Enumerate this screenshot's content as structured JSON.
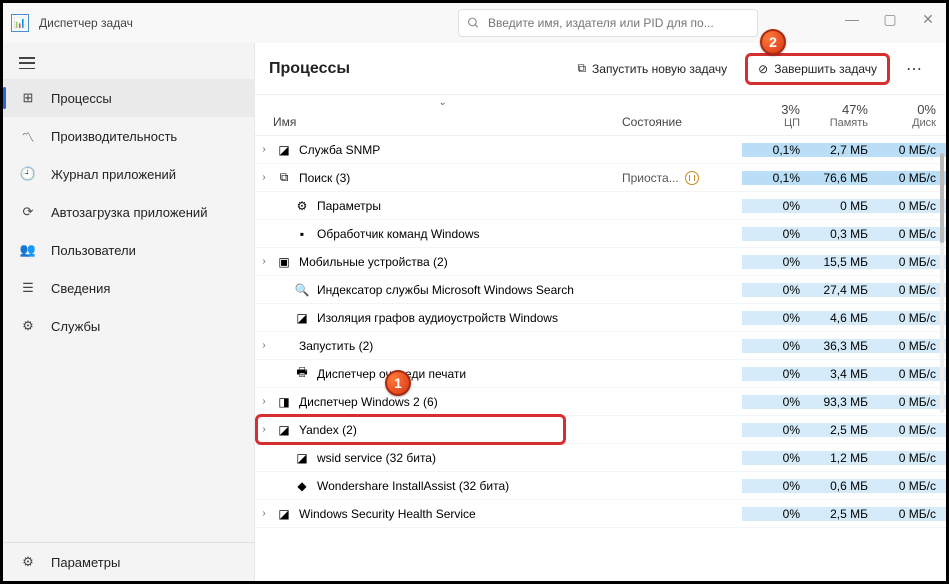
{
  "titlebar": {
    "app_title": "Диспетчер задач",
    "search_placeholder": "Введите имя, издателя или PID для по..."
  },
  "sidebar": {
    "items": [
      {
        "label": "Процессы"
      },
      {
        "label": "Производительность"
      },
      {
        "label": "Журнал приложений"
      },
      {
        "label": "Автозагрузка приложений"
      },
      {
        "label": "Пользователи"
      },
      {
        "label": "Сведения"
      },
      {
        "label": "Службы"
      }
    ],
    "settings_label": "Параметры"
  },
  "toolbar": {
    "title": "Процессы",
    "run_new_task": "Запустить новую задачу",
    "end_task": "Завершить задачу"
  },
  "columns": {
    "name": "Имя",
    "status": "Состояние",
    "cpu_pct": "3%",
    "cpu_lbl": "ЦП",
    "mem_pct": "47%",
    "mem_lbl": "Память",
    "disk_pct": "0%",
    "disk_lbl": "Диск"
  },
  "processes": [
    {
      "expand": true,
      "indent": 0,
      "icon": "◪",
      "name": "Служба SNMP",
      "status": "",
      "cpu": "0,1%",
      "mem": "2,7 МБ",
      "disk": "0 МБ/с",
      "hl": "hl"
    },
    {
      "expand": true,
      "indent": 0,
      "icon": "⧉",
      "name": "Поиск (3)",
      "status": "Приоста...",
      "paused": true,
      "cpu": "0,1%",
      "mem": "76,6 МБ",
      "disk": "0 МБ/с",
      "hl": "hl"
    },
    {
      "expand": false,
      "indent": 1,
      "icon": "⚙",
      "name": "Параметры",
      "status": "",
      "cpu": "0%",
      "mem": "0 МБ",
      "disk": "0 МБ/с",
      "hl": "hl2"
    },
    {
      "expand": false,
      "indent": 1,
      "icon": "▪",
      "name": "Обработчик команд Windows",
      "status": "",
      "cpu": "0%",
      "mem": "0,3 МБ",
      "disk": "0 МБ/с",
      "hl": "hl2"
    },
    {
      "expand": true,
      "indent": 0,
      "icon": "▣",
      "name": "Мобильные устройства (2)",
      "status": "",
      "cpu": "0%",
      "mem": "15,5 МБ",
      "disk": "0 МБ/с",
      "hl": "hl2"
    },
    {
      "expand": false,
      "indent": 1,
      "icon": "🔍",
      "name": "Индексатор службы Microsoft Windows Search",
      "status": "",
      "cpu": "0%",
      "mem": "27,4 МБ",
      "disk": "0 МБ/с",
      "hl": "hl2"
    },
    {
      "expand": false,
      "indent": 1,
      "icon": "◪",
      "name": "Изоляция графов аудиоустройств Windows",
      "status": "",
      "cpu": "0%",
      "mem": "4,6 МБ",
      "disk": "0 МБ/с",
      "hl": "hl2"
    },
    {
      "expand": true,
      "indent": 0,
      "icon": "",
      "name": "Запустить (2)",
      "status": "",
      "cpu": "0%",
      "mem": "36,3 МБ",
      "disk": "0 МБ/с",
      "hl": "hl2"
    },
    {
      "expand": false,
      "indent": 1,
      "icon": "🖶",
      "name": "Диспетчер очереди печати",
      "status": "",
      "cpu": "0%",
      "mem": "3,4 МБ",
      "disk": "0 МБ/с",
      "hl": "hl2"
    },
    {
      "expand": true,
      "indent": 0,
      "icon": "◨",
      "name": "Диспетчер Windows  2 (6)",
      "status": "",
      "cpu": "0%",
      "mem": "93,3 МБ",
      "disk": "0 МБ/с",
      "hl": "hl2",
      "callout1": true
    },
    {
      "expand": true,
      "indent": 0,
      "icon": "◪",
      "name": "Yandex (2)",
      "status": "",
      "cpu": "0%",
      "mem": "2,5 МБ",
      "disk": "0 МБ/с",
      "hl": "hl2",
      "highlighted": true
    },
    {
      "expand": false,
      "indent": 1,
      "icon": "◪",
      "name": "wsid service (32 бита)",
      "status": "",
      "cpu": "0%",
      "mem": "1,2 МБ",
      "disk": "0 МБ/с",
      "hl": "hl2"
    },
    {
      "expand": false,
      "indent": 1,
      "icon": "◆",
      "name": "Wondershare InstallAssist (32 бита)",
      "status": "",
      "cpu": "0%",
      "mem": "0,6 МБ",
      "disk": "0 МБ/с",
      "hl": "hl2"
    },
    {
      "expand": true,
      "indent": 0,
      "icon": "◪",
      "name": "Windows Security Health Service",
      "status": "",
      "cpu": "0%",
      "mem": "2,5 МБ",
      "disk": "0 МБ/с",
      "hl": "hl2"
    }
  ],
  "callouts": {
    "one": "1",
    "two": "2"
  }
}
